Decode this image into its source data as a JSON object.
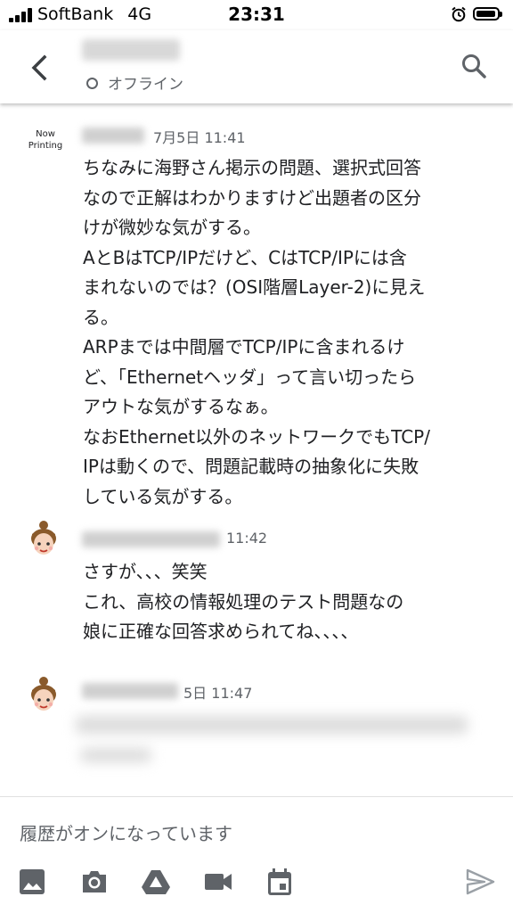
{
  "status_bar": {
    "carrier": "SoftBank",
    "network": "4G",
    "time": "23:31"
  },
  "header": {
    "presence": "オフライン"
  },
  "messages": [
    {
      "avatar_label_1": "Now",
      "avatar_label_2": "Printing",
      "timestamp": "7月5日 11:41",
      "text": "ちなみに海野さん掲示の問題、選択式回答\nなので正解はわかりますけど出題者の区分\nけが微妙な気がする。\nAとBはTCP/IPだけど、CはTCP/IPには含\nまれないのでは？(OSI階層Layer-2)に見え\nる。\nARPまでは中間層でTCP/IPに含まれるけ\nど、「Ethernetヘッダ」って言い切ったら\nアウトな気がするなぁ。\nなおEthernet以外のネットワークでもTCP/\nIPは動くので、問題記載時の抽象化に失敗\nしている気がする。"
    },
    {
      "timestamp": "11:42",
      "text": "さすが、、、笑笑\nこれ、高校の情報処理のテスト問題なの\n娘に正確な回答求められてね、、、、"
    },
    {
      "timestamp": "5日 11:47"
    }
  ],
  "compose": {
    "placeholder": "履歴がオンになっています"
  },
  "toolbar": [
    "image-icon",
    "camera-icon",
    "drive-icon",
    "video-icon",
    "calendar-icon",
    "send-icon"
  ],
  "colors": {
    "text": "#202124",
    "secondary": "#5f6368",
    "icon": "#5f6368",
    "send_disabled": "#9aa0a6"
  }
}
